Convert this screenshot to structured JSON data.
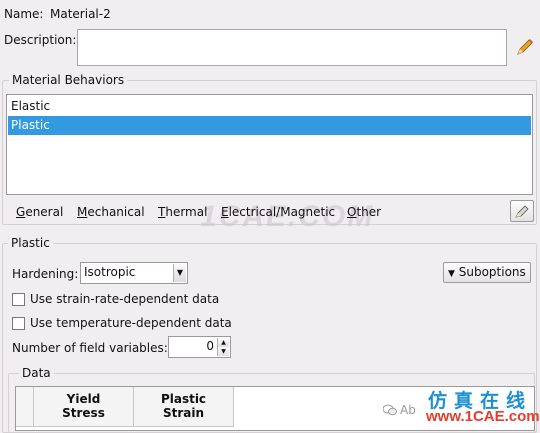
{
  "name": {
    "label": "Name:",
    "value": "Material-2"
  },
  "description": {
    "label": "Description:",
    "value": ""
  },
  "material_behaviors": {
    "title": "Material Behaviors",
    "items": [
      {
        "label": "Elastic",
        "selected": false
      },
      {
        "label": "Plastic",
        "selected": true
      }
    ]
  },
  "menu": {
    "items": [
      {
        "underline": "G",
        "rest": "eneral"
      },
      {
        "underline": "M",
        "rest": "echanical"
      },
      {
        "underline": "T",
        "rest": "hermal"
      },
      {
        "underline": "E",
        "rest": "lectrical/Magnetic"
      },
      {
        "underline": "O",
        "rest": "ther"
      }
    ]
  },
  "plastic": {
    "title": "Plastic",
    "hardening": {
      "label": "Hardening:",
      "value": "Isotropic"
    },
    "suboptions_label": "Suboptions",
    "checkboxes": [
      {
        "label": "Use strain-rate-dependent data",
        "checked": false
      },
      {
        "label": "Use temperature-dependent data",
        "checked": false
      }
    ],
    "field_variables": {
      "label": "Number of field variables:",
      "value": "0"
    },
    "data": {
      "title": "Data",
      "columns": [
        {
          "line1": "Yield",
          "line2": "Stress"
        },
        {
          "line1": "Plastic",
          "line2": "Strain"
        }
      ]
    }
  },
  "watermarks": {
    "chinese": "仿真在线",
    "url": "www.1CAE.com",
    "faint": "1CAE.COM",
    "wechat_prefix": "Ab"
  },
  "colors": {
    "selection": "#3399e0",
    "background": "#f1eef1"
  }
}
